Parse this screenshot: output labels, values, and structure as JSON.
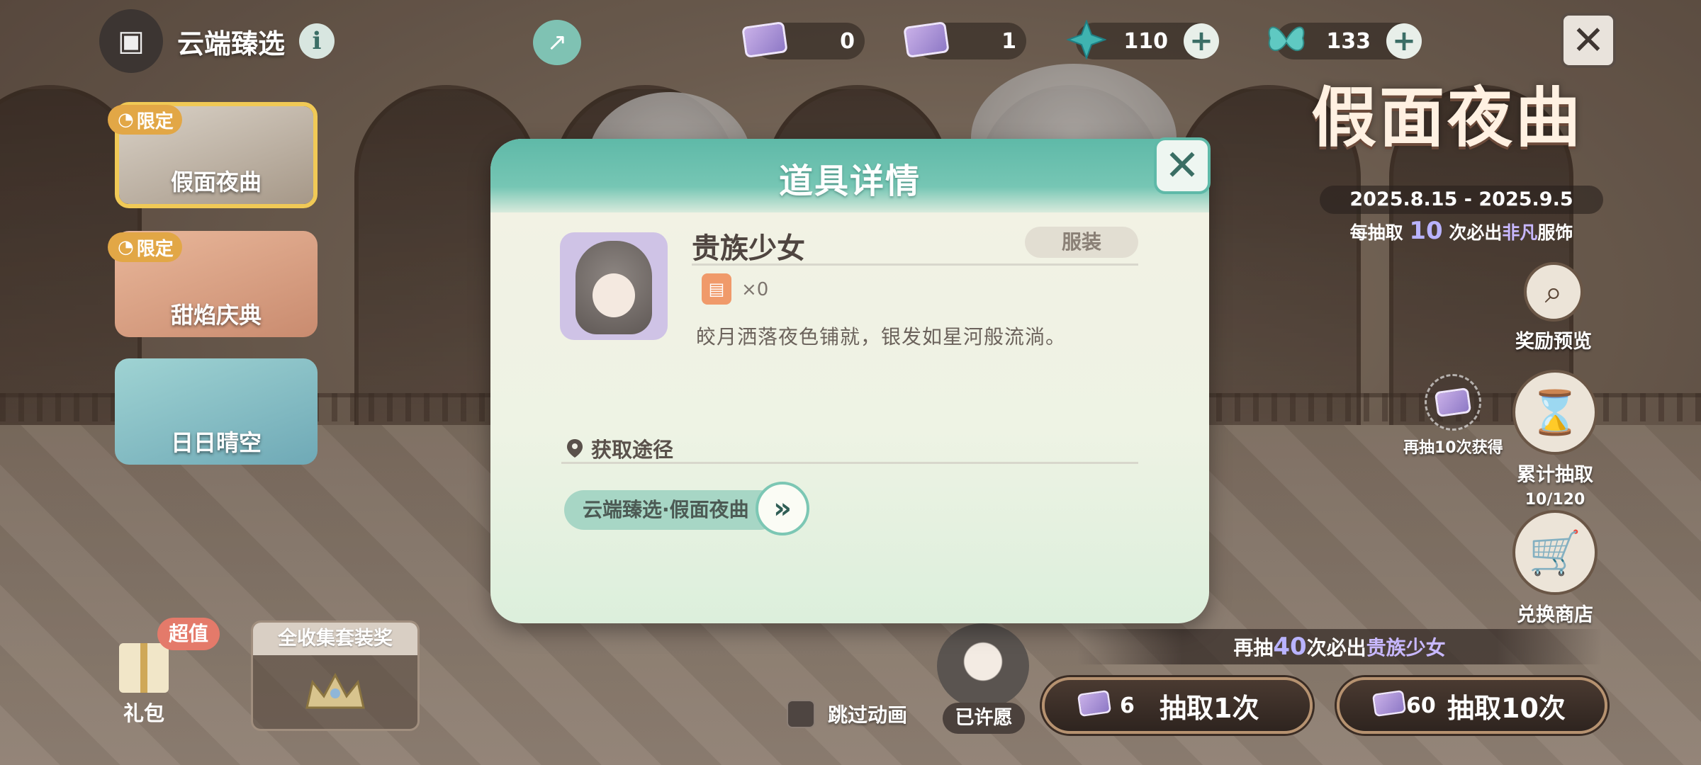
{
  "top": {
    "title": "云端臻选",
    "currencies": [
      {
        "value": "0",
        "icon": "wish-ticket-icon"
      },
      {
        "value": "1",
        "icon": "wish-ticket-purple-icon"
      },
      {
        "value": "110",
        "icon": "star-gem-icon"
      },
      {
        "value": "133",
        "icon": "butterfly-gem-icon"
      }
    ]
  },
  "banners": [
    {
      "label": "假面夜曲",
      "tag": "限定",
      "selected": true
    },
    {
      "label": "甜焰庆典",
      "tag": "限定",
      "selected": false
    },
    {
      "label": "日日晴空",
      "tag": "",
      "selected": false
    }
  ],
  "event": {
    "logo": "假面夜曲",
    "date": "2025.8.15 - 2025.9.5",
    "note_prefix": "每抽取",
    "note_num": "10",
    "note_mid": "次必出",
    "note_hl": "非凡",
    "note_suffix": "服饰"
  },
  "side": {
    "preview_label": "奖励预览",
    "bonus_label": "再抽10次获得",
    "cumulative_label": "累计抽取",
    "cumulative_progress": "10/120",
    "shop_label": "兑换商店"
  },
  "bottom": {
    "gift_label": "礼包",
    "super_tag": "超值",
    "collect_title": "全收集套装奖",
    "skip_label": "跳过动画",
    "wished_label": "已许愿",
    "guarantee_prefix": "再抽",
    "guarantee_num": "40",
    "guarantee_mid": "次必出",
    "guarantee_hl": "贵族少女",
    "draw1_cost": "6",
    "draw1_label": "抽取1次",
    "draw10_cost": "60",
    "draw10_label": "抽取10次"
  },
  "modal": {
    "title": "道具详情",
    "item_name": "贵族少女",
    "item_type": "服装",
    "owned": "×0",
    "description": "皎月洒落夜色铺就，银发如星河般流淌。",
    "source_title": "获取途径",
    "source_link": "云端臻选·假面夜曲"
  },
  "colors": {
    "accent_teal": "#5fb9a8",
    "selected_gold": "#f0c956",
    "highlight_purple": "#b9b3ff"
  }
}
